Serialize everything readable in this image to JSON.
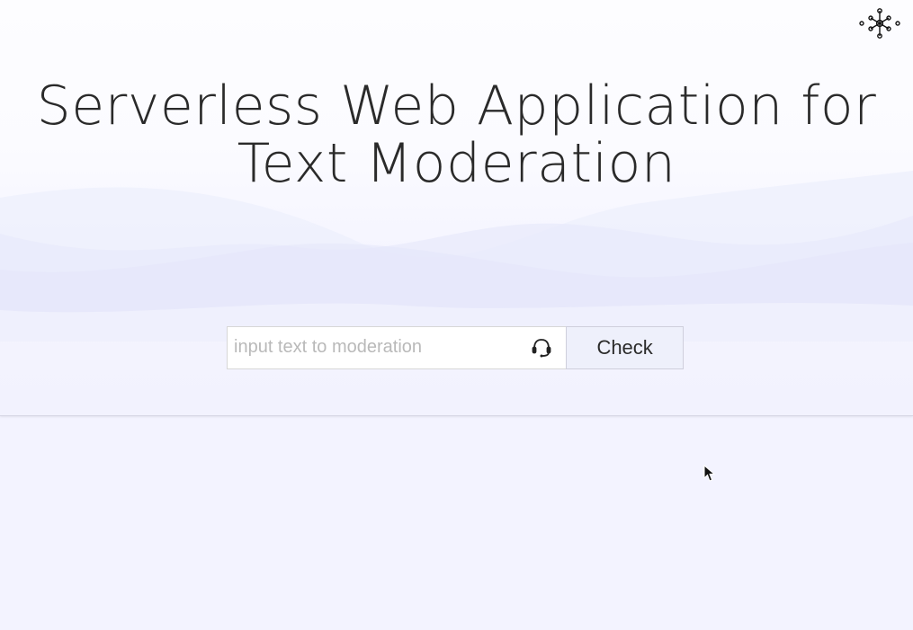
{
  "header": {
    "title": "Serverless Web Application for Text Moderation",
    "logo_icon": "neural-network-logo-icon"
  },
  "search": {
    "placeholder": "input text to moderation",
    "value": "",
    "voice_icon": "headset-icon",
    "submit_label": "Check"
  },
  "colors": {
    "page_background": "#f3f3ff",
    "wave_tint": "#e3e5fb",
    "button_background": "#eef0fb"
  }
}
